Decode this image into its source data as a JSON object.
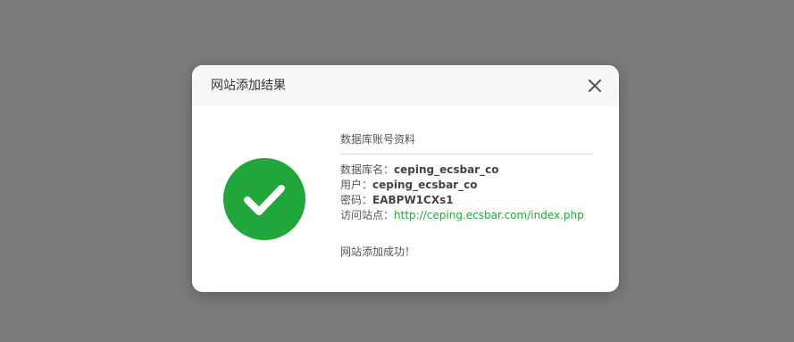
{
  "dialog": {
    "title": "网站添加结果",
    "close_icon": "close-icon"
  },
  "status": {
    "icon": "check-circle-icon",
    "color": "#21a63b"
  },
  "db_info": {
    "section_title": "数据库账号资料",
    "db_name_label": "数据库名：",
    "db_name_value": "ceping_ecsbar_co",
    "user_label": "用户：",
    "user_value": "ceping_ecsbar_co",
    "password_label": "密码：",
    "password_value": "EABPW1CXs1",
    "site_label": "访问站点：",
    "site_url": "http://ceping.ecsbar.com/index.php"
  },
  "result_message": "网站添加成功！"
}
